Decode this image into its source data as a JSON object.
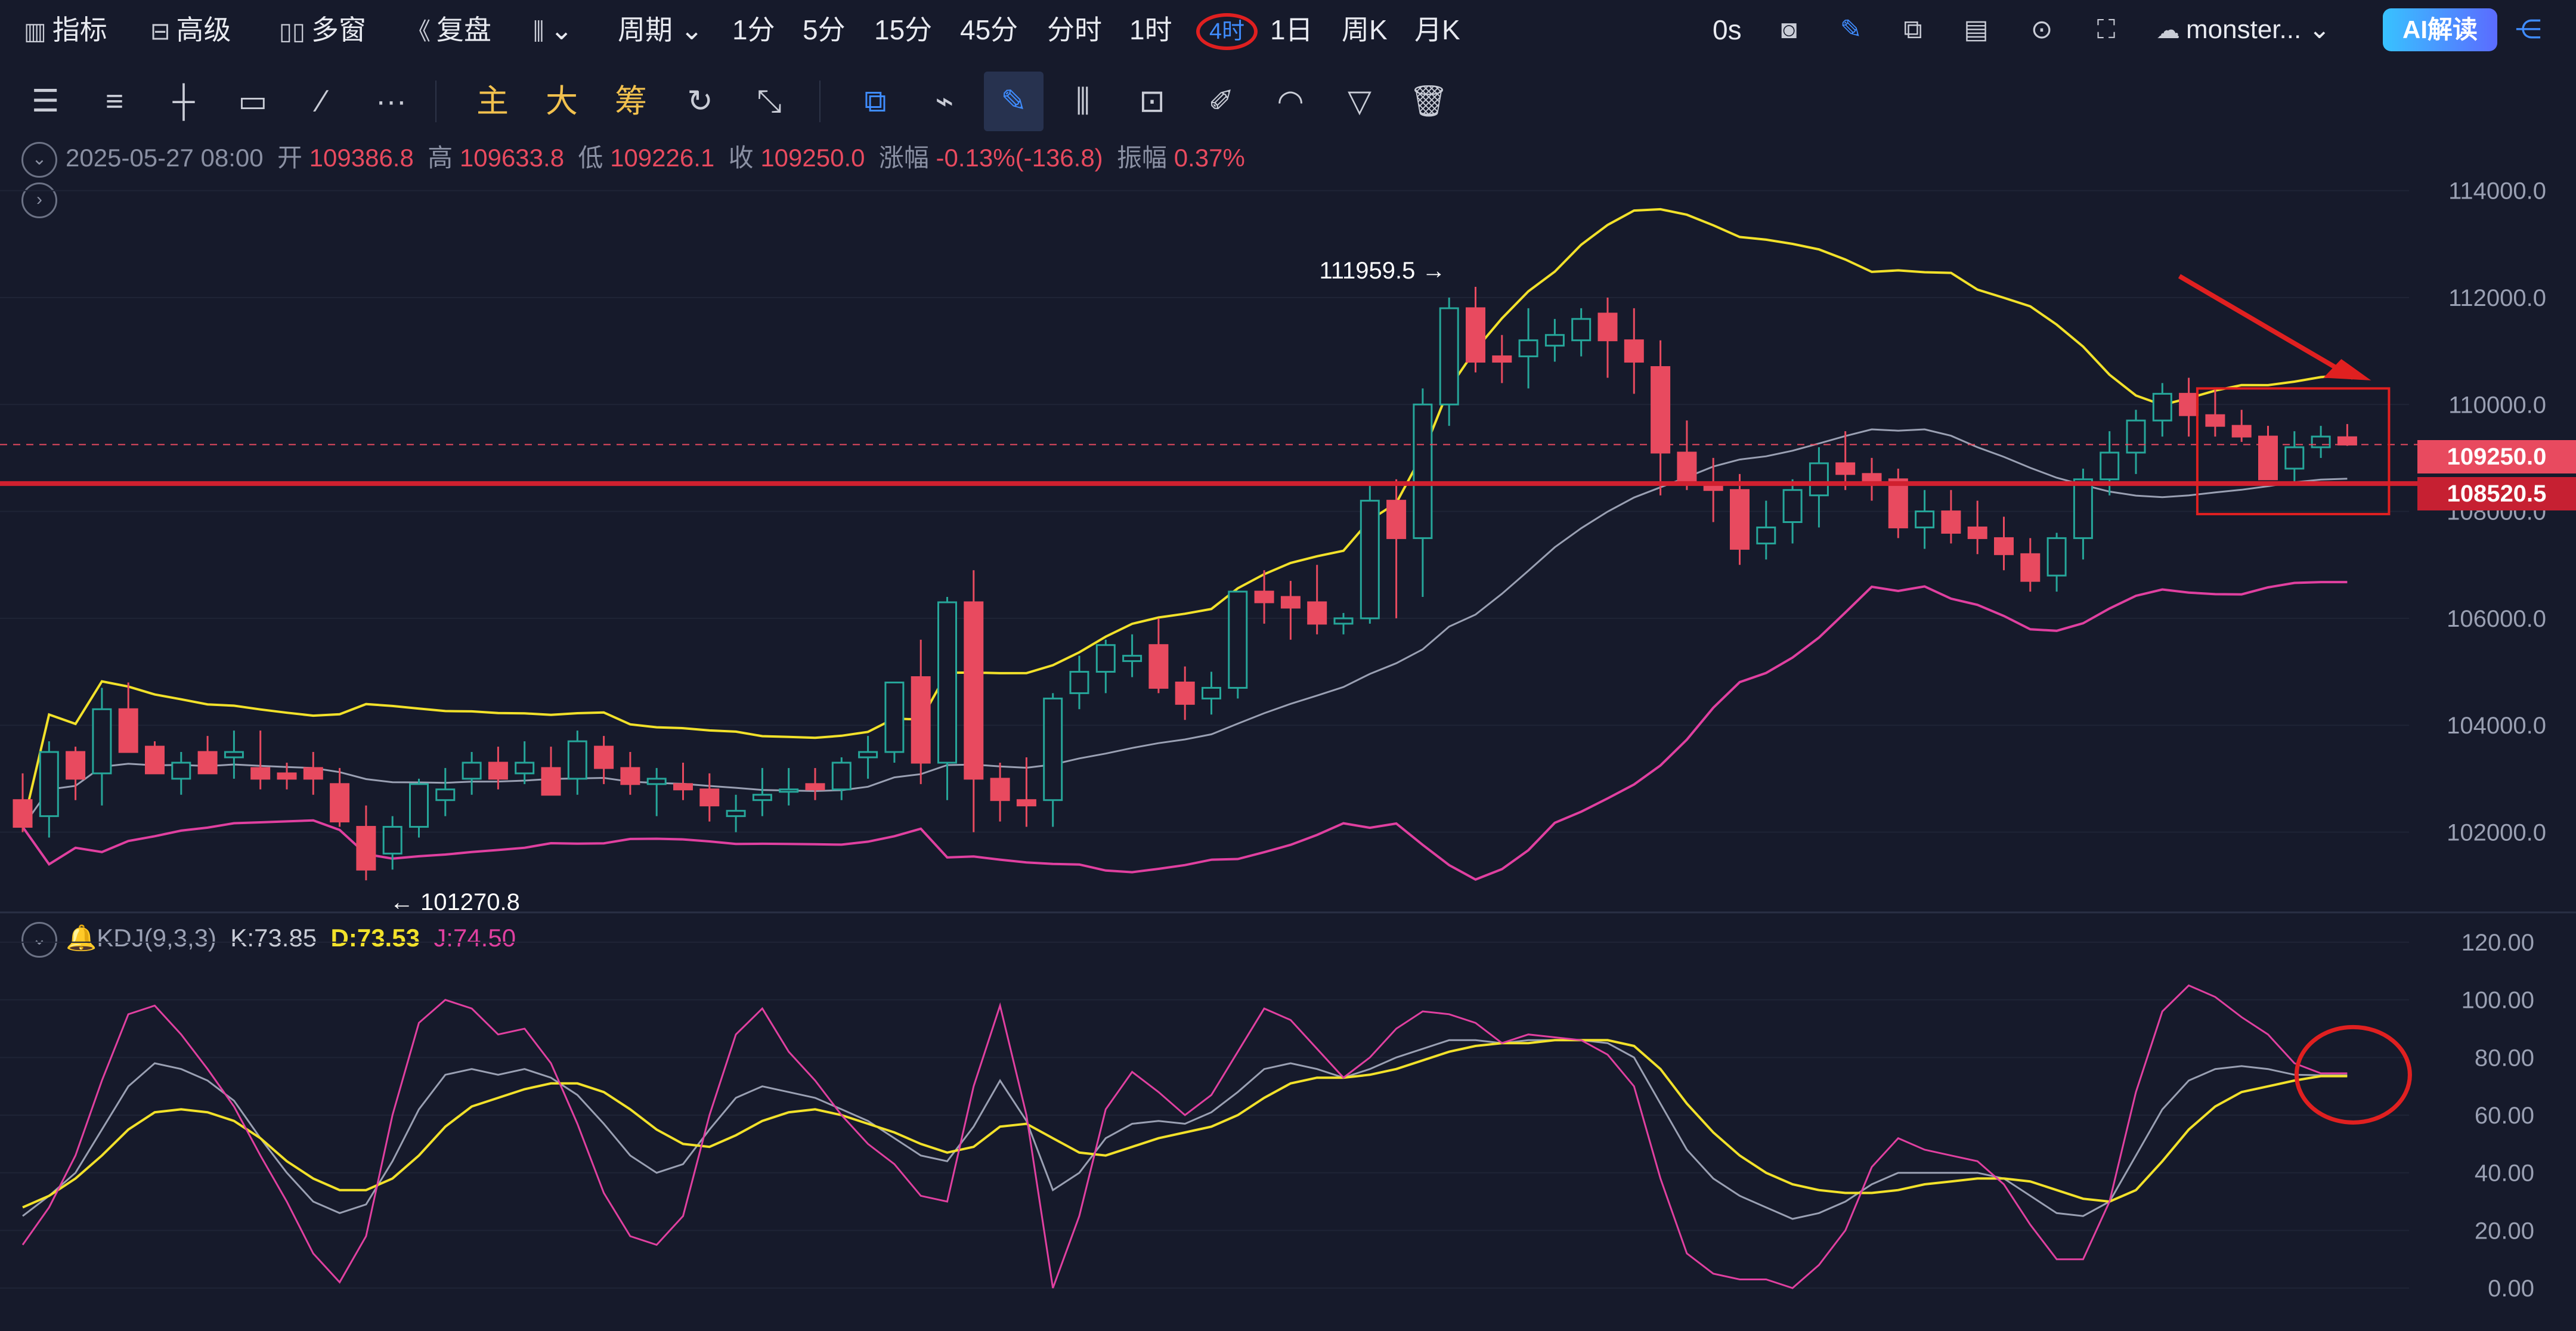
{
  "toolbar": {
    "indicators": "指标",
    "advanced": "高级",
    "multi_window": "多窗",
    "replay": "复盘",
    "chart_type_icon": "candlestick-icon",
    "period": "周期",
    "intervals": [
      "1分",
      "5分",
      "15分",
      "45分",
      "分时",
      "1时",
      "4时",
      "1日",
      "周K",
      "月K"
    ],
    "active_interval": "4时",
    "timer": "0s",
    "account": "monster...",
    "ai_button": "AI解读"
  },
  "drawing_toolbar": {
    "labels": [
      "主",
      "大",
      "筹"
    ],
    "icons": [
      "menu-lines-icon",
      "horizontal-lines-icon",
      "cross-line-icon",
      "rectangle-icon",
      "trend-line-icon",
      "more-icon",
      "fib-icon",
      "magnet-icon",
      "copy-icon",
      "ruler-icon",
      "pen-icon",
      "candles-icon",
      "lock-icon",
      "note-icon",
      "brush-icon",
      "filter-icon",
      "trash-icon"
    ]
  },
  "ohlc": {
    "date": "2025-05-27 08:00",
    "open_label": "开",
    "open": "109386.8",
    "high_label": "高",
    "high": "109633.8",
    "low_label": "低",
    "low": "109226.1",
    "close_label": "收",
    "close": "109250.0",
    "change_label": "涨幅",
    "change": "-0.13%(-136.8)",
    "amp_label": "振幅",
    "amp": "0.37%"
  },
  "kdj": {
    "name": "KDJ(9,3,3)",
    "k_text": "K:73.85",
    "d_text": "D:73.53",
    "j_text": "J:74.50"
  },
  "price_tags": {
    "current": "109250.0",
    "marked": "108520.5"
  },
  "annotations": {
    "high": "111959.5",
    "low": "101270.8"
  },
  "colors": {
    "background": "#161a2b",
    "up": "#26a69a",
    "down": "#e84a5f",
    "boll_upper": "#f2e12a",
    "boll_mid": "#9aa0b3",
    "boll_lower": "#e040a0",
    "annotation": "#e02020"
  },
  "chart_data": [
    {
      "type": "candlestick",
      "y_axis_ticks": [
        "114000.0",
        "112000.0",
        "110000.0",
        "108000.0",
        "106000.0",
        "104000.0",
        "102000.0"
      ],
      "ylim": [
        100500,
        115000
      ],
      "candles": [
        [
          102600,
          103100,
          102000,
          102100
        ],
        [
          102300,
          103700,
          101900,
          103500
        ],
        [
          103500,
          103600,
          102600,
          103000
        ],
        [
          103100,
          104700,
          102500,
          104300
        ],
        [
          104300,
          104800,
          103500,
          103500
        ],
        [
          103600,
          103700,
          103100,
          103100
        ],
        [
          103000,
          103500,
          102700,
          103300
        ],
        [
          103500,
          103800,
          103100,
          103100
        ],
        [
          103400,
          103900,
          103000,
          103500
        ],
        [
          103200,
          103900,
          102800,
          103000
        ],
        [
          103100,
          103300,
          102800,
          103000
        ],
        [
          103200,
          103500,
          102700,
          103000
        ],
        [
          102900,
          103200,
          102100,
          102200
        ],
        [
          102100,
          102500,
          101100,
          101300
        ],
        [
          101600,
          102300,
          101300,
          102100
        ],
        [
          102100,
          103000,
          101900,
          102900
        ],
        [
          102600,
          103200,
          102300,
          102800
        ],
        [
          103000,
          103500,
          102700,
          103300
        ],
        [
          103300,
          103600,
          102800,
          103000
        ],
        [
          103100,
          103700,
          102900,
          103300
        ],
        [
          103200,
          103600,
          102700,
          102700
        ],
        [
          103000,
          103900,
          102700,
          103700
        ],
        [
          103600,
          103800,
          102900,
          103200
        ],
        [
          103200,
          103500,
          102700,
          102900
        ],
        [
          102900,
          103200,
          102300,
          103000
        ],
        [
          102900,
          103300,
          102600,
          102800
        ],
        [
          102800,
          103100,
          102200,
          102500
        ],
        [
          102300,
          102700,
          102000,
          102400
        ],
        [
          102600,
          103200,
          102300,
          102700
        ],
        [
          102800,
          103200,
          102500,
          102800
        ],
        [
          102900,
          103200,
          102600,
          102800
        ],
        [
          102800,
          103400,
          102600,
          103300
        ],
        [
          103400,
          103800,
          103000,
          103500
        ],
        [
          103500,
          104800,
          103300,
          104800
        ],
        [
          104900,
          105600,
          102900,
          103300
        ],
        [
          103300,
          106400,
          102600,
          106300
        ],
        [
          106300,
          106900,
          102000,
          103000
        ],
        [
          103000,
          103300,
          102200,
          102600
        ],
        [
          102600,
          103400,
          102100,
          102500
        ],
        [
          102600,
          104600,
          102100,
          104500
        ],
        [
          104600,
          105300,
          104300,
          105000
        ],
        [
          105000,
          105600,
          104600,
          105500
        ],
        [
          105200,
          105700,
          104900,
          105300
        ],
        [
          105500,
          106000,
          104600,
          104700
        ],
        [
          104800,
          105100,
          104100,
          104400
        ],
        [
          104500,
          105000,
          104200,
          104700
        ],
        [
          104700,
          106500,
          104500,
          106500
        ],
        [
          106500,
          106900,
          105900,
          106300
        ],
        [
          106400,
          106700,
          105600,
          106200
        ],
        [
          106300,
          107000,
          105700,
          105900
        ],
        [
          105900,
          106100,
          105700,
          106000
        ],
        [
          106000,
          108500,
          105900,
          108200
        ],
        [
          108200,
          108600,
          106000,
          107500
        ],
        [
          107500,
          110300,
          106400,
          110000
        ],
        [
          110000,
          112000,
          109600,
          111800
        ],
        [
          111800,
          112200,
          110600,
          110800
        ],
        [
          110900,
          111300,
          110400,
          110800
        ],
        [
          110900,
          111800,
          110300,
          111200
        ],
        [
          111100,
          111600,
          110800,
          111300
        ],
        [
          111200,
          111800,
          110900,
          111600
        ],
        [
          111700,
          112000,
          110500,
          111200
        ],
        [
          111200,
          111800,
          110200,
          110800
        ],
        [
          110700,
          111200,
          108300,
          109100
        ],
        [
          109100,
          109700,
          108400,
          108500
        ],
        [
          108500,
          109000,
          107800,
          108400
        ],
        [
          108400,
          108700,
          107000,
          107300
        ],
        [
          107400,
          108200,
          107100,
          107700
        ],
        [
          107800,
          108600,
          107400,
          108400
        ],
        [
          108300,
          109200,
          107700,
          108900
        ],
        [
          108900,
          109500,
          108400,
          108700
        ],
        [
          108700,
          109000,
          108200,
          108500
        ],
        [
          108600,
          108800,
          107500,
          107700
        ],
        [
          107700,
          108400,
          107300,
          108000
        ],
        [
          108000,
          108400,
          107400,
          107600
        ],
        [
          107700,
          108200,
          107200,
          107500
        ],
        [
          107500,
          107900,
          106900,
          107200
        ],
        [
          107200,
          107500,
          106500,
          106700
        ],
        [
          106800,
          107600,
          106500,
          107500
        ],
        [
          107500,
          108800,
          107100,
          108600
        ],
        [
          108600,
          109500,
          108300,
          109100
        ],
        [
          109100,
          109900,
          108700,
          109700
        ],
        [
          109700,
          110400,
          109400,
          110200
        ],
        [
          110200,
          110500,
          109400,
          109800
        ],
        [
          109800,
          110300,
          109400,
          109600
        ],
        [
          109600,
          109900,
          109300,
          109400
        ],
        [
          109400,
          109600,
          108600,
          108600
        ],
        [
          108800,
          109500,
          108500,
          109200
        ],
        [
          109200,
          109600,
          109000,
          109400
        ],
        [
          109386.8,
          109633.8,
          109226.1,
          109250.0
        ]
      ]
    },
    {
      "type": "line",
      "x": [
        0,
        1,
        2,
        3,
        4,
        5,
        6,
        7,
        8,
        9,
        10,
        11,
        12,
        13,
        14,
        15,
        16,
        17,
        18,
        19,
        20,
        21,
        22,
        23,
        24,
        25,
        26,
        27,
        28,
        29,
        30,
        31,
        32,
        33,
        34,
        35,
        36,
        37,
        38,
        39,
        40,
        41,
        42,
        43,
        44,
        45,
        46,
        47,
        48,
        49,
        50,
        51,
        52,
        53,
        54,
        55,
        56,
        57,
        58,
        59,
        60,
        61,
        62,
        63,
        64,
        65,
        66,
        67,
        68,
        69,
        70,
        71,
        72,
        73,
        74,
        75,
        76,
        77,
        78,
        79,
        80,
        81,
        82,
        83,
        84,
        85,
        86,
        87,
        88
      ],
      "series": [
        {
          "name": "K",
          "values": [
            25,
            32,
            40,
            55,
            70,
            78,
            76,
            72,
            65,
            52,
            40,
            30,
            26,
            29,
            44,
            62,
            74,
            76,
            74,
            76,
            73,
            67,
            57,
            46,
            40,
            43,
            55,
            66,
            70,
            68,
            66,
            62,
            58,
            52,
            46,
            44,
            56,
            72,
            58,
            34,
            40,
            52,
            57,
            58,
            57,
            61,
            68,
            76,
            78,
            76,
            73,
            76,
            80,
            83,
            86,
            86,
            85,
            86,
            86,
            86,
            85,
            80,
            64,
            48,
            38,
            32,
            28,
            24,
            26,
            30,
            36,
            40,
            40,
            40,
            40,
            38,
            32,
            26,
            25,
            30,
            46,
            62,
            72,
            76,
            77,
            76,
            74,
            73.85,
            73.85
          ]
        },
        {
          "name": "D",
          "values": [
            28,
            32,
            38,
            46,
            55,
            61,
            62,
            61,
            58,
            52,
            44,
            38,
            34,
            34,
            38,
            46,
            56,
            63,
            66,
            69,
            71,
            71,
            68,
            62,
            55,
            50,
            49,
            53,
            58,
            61,
            62,
            60,
            57,
            54,
            50,
            47,
            49,
            56,
            57,
            52,
            47,
            46,
            49,
            52,
            54,
            56,
            60,
            66,
            71,
            73,
            73,
            74,
            76,
            79,
            82,
            84,
            85,
            85,
            86,
            86,
            86,
            84,
            76,
            64,
            54,
            46,
            40,
            36,
            34,
            33,
            33,
            34,
            36,
            37,
            38,
            38,
            37,
            34,
            31,
            30,
            34,
            44,
            55,
            63,
            68,
            70,
            72,
            73.53,
            73.53
          ]
        },
        {
          "name": "J",
          "values": [
            15,
            28,
            46,
            72,
            95,
            98,
            88,
            76,
            63,
            46,
            30,
            12,
            2,
            18,
            60,
            92,
            100,
            97,
            88,
            90,
            78,
            57,
            33,
            18,
            15,
            25,
            60,
            88,
            97,
            82,
            72,
            60,
            50,
            43,
            32,
            30,
            70,
            98,
            60,
            0,
            25,
            62,
            75,
            68,
            60,
            67,
            82,
            97,
            93,
            83,
            73,
            80,
            90,
            96,
            95,
            92,
            85,
            88,
            87,
            86,
            81,
            70,
            38,
            12,
            5,
            3,
            3,
            0,
            8,
            20,
            42,
            52,
            48,
            46,
            44,
            36,
            22,
            10,
            10,
            30,
            68,
            96,
            105,
            101,
            94,
            88,
            78,
            74.5,
            74.5
          ]
        }
      ],
      "y_axis_ticks": [
        "120.00",
        "100.00",
        "80.00",
        "60.00",
        "40.00",
        "20.00",
        "0.00"
      ],
      "ylim": [
        0,
        120
      ]
    }
  ]
}
